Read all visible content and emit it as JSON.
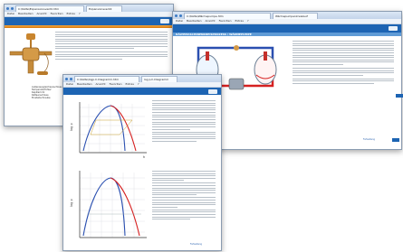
{
  "win1": {
    "tab": "C:\\Kälte\\Expansionsventil.htm",
    "tab2": "Expansionsventil",
    "menu": [
      "Datei",
      "Bearbeiten",
      "Ansicht",
      "Favoriten",
      "Extras",
      "?"
    ],
    "legend": [
      "Außenausgleichsanschluss",
      "Temperaturfühler",
      "Kapillarrohr",
      "Kälteanschluss",
      "Einstellschraube"
    ],
    "link": "Fortsetzung"
  },
  "win2": {
    "tab": "C:\\Kälte\\Wärmepumpe.htm",
    "tab2": "Wärmepumpenkreislauf",
    "menu": [
      "Datei",
      "Bearbeiten",
      "Ansicht",
      "Favoriten",
      "Extras",
      "?"
    ],
    "title": "KÄLTEMASCHINENKREISPROZESS / WÄRMEPUMPE",
    "link": "Fortsetzung"
  },
  "win3": {
    "tab": "C:\\Kälte\\logp-h-Diagramm.htm",
    "tab2": "log p,h-Diagramm",
    "menu": [
      "Datei",
      "Bearbeiten",
      "Ansicht",
      "Favoriten",
      "Extras",
      "?"
    ],
    "ylabel": "log p",
    "xlabel": "h",
    "link": "Fortsetzung"
  },
  "colors": {
    "accent": "#1d64b3",
    "red": "#d62020",
    "blue": "#2a4fb0"
  }
}
